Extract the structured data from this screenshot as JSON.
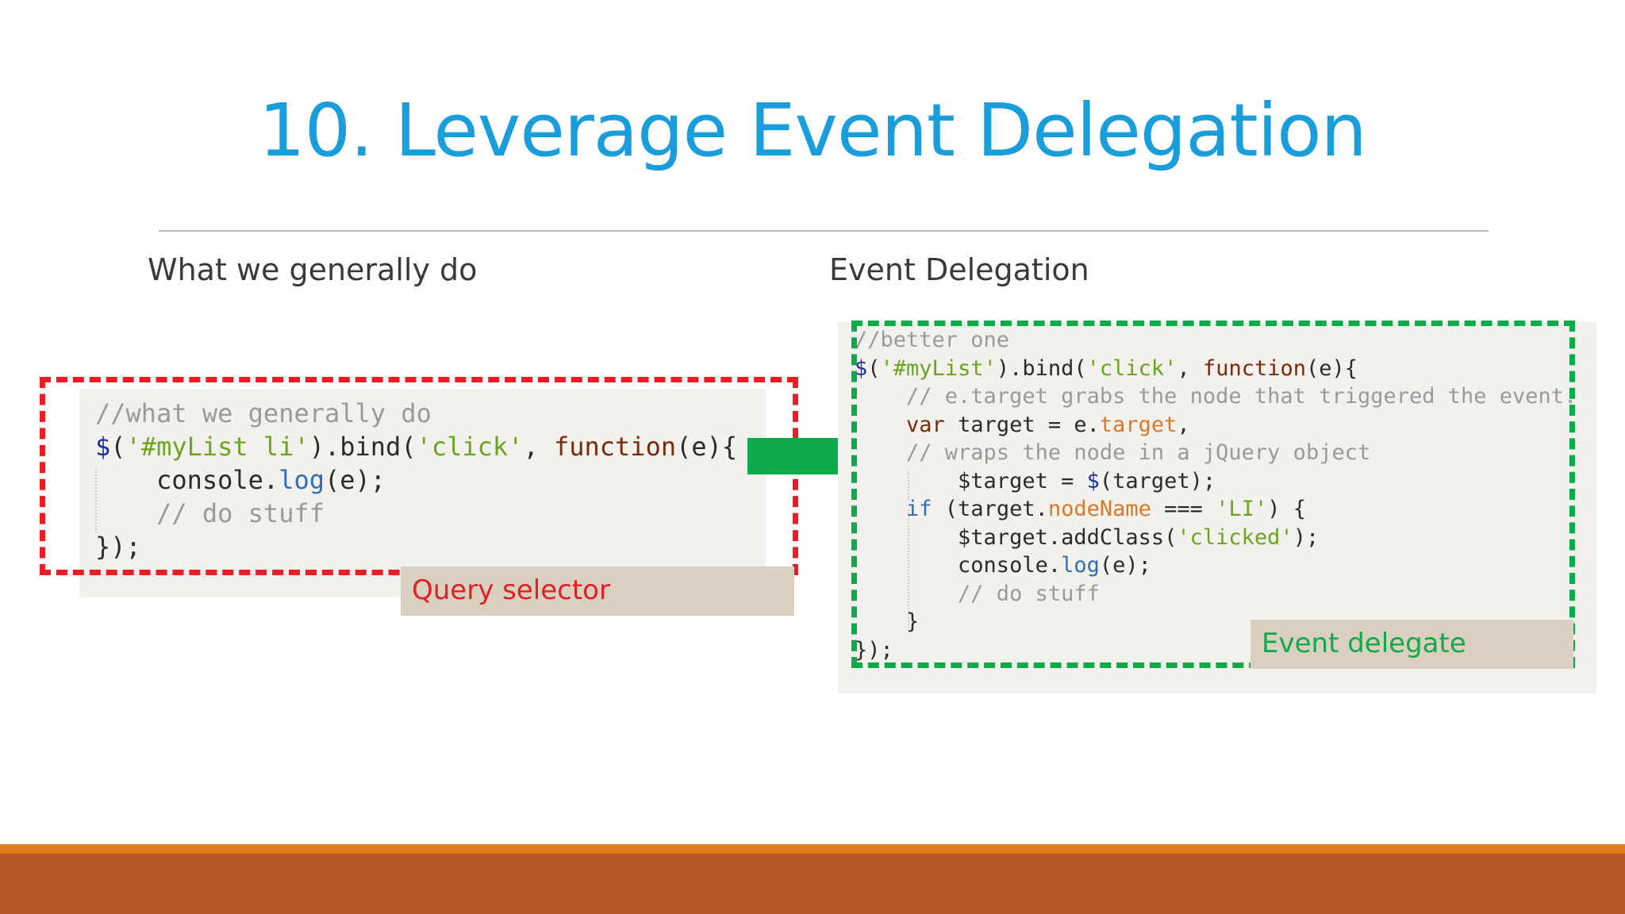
{
  "slide": {
    "title": "10. Leverage Event Delegation",
    "left_heading": "What we generally do",
    "right_heading": "Event Delegation",
    "left_label": "Query selector",
    "right_label": "Event delegate",
    "colors": {
      "title": "#1a9ddb",
      "left_box_border": "#ec1c24",
      "right_box_border": "#0bab49",
      "arrow": "#0bab49",
      "left_label_text": "#e31e24",
      "right_label_text": "#12a94b",
      "footer_orange": "#e07c1b",
      "footer_rust": "#b95627"
    },
    "icons": [
      "right-arrow-icon"
    ]
  },
  "left_code": [
    [
      {
        "t": "//what we generally do",
        "c": "comment"
      }
    ],
    [
      {
        "t": "$",
        "c": "dollar"
      },
      {
        "t": "(",
        "c": "plain"
      },
      {
        "t": "'#myList li'",
        "c": "string"
      },
      {
        "t": ").bind(",
        "c": "plain"
      },
      {
        "t": "'click'",
        "c": "string"
      },
      {
        "t": ", ",
        "c": "plain"
      },
      {
        "t": "function",
        "c": "keyword"
      },
      {
        "t": "(e){",
        "c": "plain"
      }
    ],
    [
      {
        "t": "    console.",
        "c": "plain"
      },
      {
        "t": "log",
        "c": "method"
      },
      {
        "t": "(e);",
        "c": "plain"
      }
    ],
    [
      {
        "t": "    // do stuff",
        "c": "comment"
      }
    ],
    [
      {
        "t": "});",
        "c": "plain"
      }
    ]
  ],
  "right_code": [
    [
      {
        "t": "//better one",
        "c": "comment"
      }
    ],
    [
      {
        "t": "$",
        "c": "dollar"
      },
      {
        "t": "(",
        "c": "plain"
      },
      {
        "t": "'#myList'",
        "c": "string"
      },
      {
        "t": ").bind(",
        "c": "plain"
      },
      {
        "t": "'click'",
        "c": "string"
      },
      {
        "t": ", ",
        "c": "plain"
      },
      {
        "t": "function",
        "c": "keyword"
      },
      {
        "t": "(e){",
        "c": "plain"
      }
    ],
    [
      {
        "t": "    // e.target grabs the node that triggered the event.",
        "c": "comment"
      }
    ],
    [
      {
        "t": "    ",
        "c": "plain"
      },
      {
        "t": "var",
        "c": "keyword"
      },
      {
        "t": " target = e.",
        "c": "plain"
      },
      {
        "t": "target",
        "c": "prop"
      },
      {
        "t": ",",
        "c": "plain"
      }
    ],
    [
      {
        "t": "    // wraps the node in a jQuery object",
        "c": "comment"
      }
    ],
    [
      {
        "t": "        $target = ",
        "c": "plain"
      },
      {
        "t": "$",
        "c": "dollar"
      },
      {
        "t": "(target);",
        "c": "plain"
      }
    ],
    [
      {
        "t": "    ",
        "c": "plain"
      },
      {
        "t": "if",
        "c": "method"
      },
      {
        "t": " (target.",
        "c": "plain"
      },
      {
        "t": "nodeName",
        "c": "prop"
      },
      {
        "t": " === ",
        "c": "plain"
      },
      {
        "t": "'LI'",
        "c": "string"
      },
      {
        "t": ") {",
        "c": "plain"
      }
    ],
    [
      {
        "t": "        $target.addClass(",
        "c": "plain"
      },
      {
        "t": "'clicked'",
        "c": "string"
      },
      {
        "t": ");",
        "c": "plain"
      }
    ],
    [
      {
        "t": "        console.",
        "c": "plain"
      },
      {
        "t": "log",
        "c": "method"
      },
      {
        "t": "(e);",
        "c": "plain"
      }
    ],
    [
      {
        "t": "        // do stuff",
        "c": "comment"
      }
    ],
    [
      {
        "t": "    }",
        "c": "plain"
      }
    ],
    [
      {
        "t": "});",
        "c": "plain"
      }
    ]
  ]
}
